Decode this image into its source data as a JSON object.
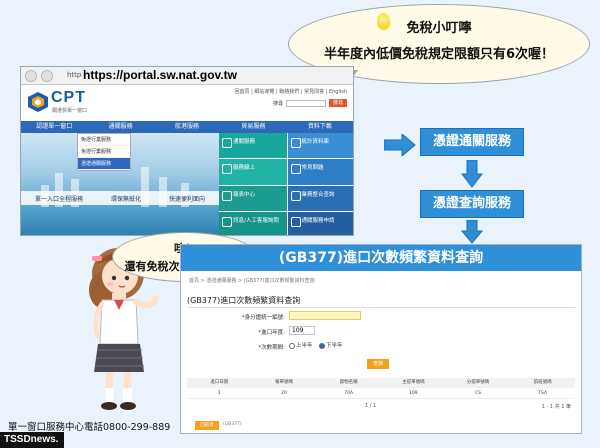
{
  "colors": {
    "accent_blue": "#2f8fd8",
    "menu_blue": "#2c69b6",
    "orange": "#f3a11b",
    "bubble": "#fffbe8"
  },
  "top_bubble": {
    "line1": "免稅小叮嚀",
    "line2": "半年度內低價免稅規定限額只有6次喔！",
    "icon": "lightbulb-icon"
  },
  "browser": {
    "url_prefix": "http",
    "url": "https://portal.sw.nat.gov.tw",
    "logo": "CPT",
    "logo_sub": "關港貿單一窗口",
    "top_links": "回首頁 | 網站導覽 | 聯絡我們 | 常見問答 | English",
    "search_label": "搜尋",
    "search_button": "搜尋",
    "menu": [
      "認證單一窗口",
      "通關服務",
      "航港服務",
      "貿易服務",
      "資料下載"
    ],
    "dropdown": [
      "免證行業服務",
      "免證行業服務",
      "憑證通關服務"
    ],
    "hero_links": [
      "單一入口全程服務",
      "環保無紙化",
      "快速便利面向"
    ],
    "tiles": [
      "通關服務",
      "統計資料庫",
      "服務線上",
      "常見問題",
      "報表中心",
      "業務整合查詢",
      "訊息/人工客服詢問",
      "通關服務申請"
    ]
  },
  "flow": {
    "box1": "憑證通關服務",
    "box2": "憑證查詢服務"
  },
  "wa_bubble": {
    "line1": "哇！",
    "line2": "還有免稅次數可用真好！"
  },
  "panel": {
    "title": "(GB377)進口次數頻繁資料查詢",
    "breadcrumb": "首頁 > 憑證通關服務 > (GB377)進口次數頻繁資料查詢",
    "page_title": "(GB377)進口次數頻繁資料查詢",
    "field1_label": "*身分證統一編號:",
    "field1_value": "",
    "field2_label": "*進口年度:",
    "field2_value": "109",
    "field3_label": "*次數期間:",
    "radio1": "上半年",
    "radio2": "下半年",
    "query_button": "查詢",
    "columns": [
      "進口日期",
      "報單號碼",
      "貨物名稱",
      "主提單號碼",
      "分提單號碼",
      "航班號碼"
    ],
    "row": [
      "1",
      "20",
      "70A",
      "109",
      "CS",
      "TSA"
    ],
    "pager": "1  /  1",
    "pager_right": "1 - 1 共 1 筆",
    "footer_button": "回前頁",
    "footer_tag": "(GB377)"
  },
  "hotline": "單一窗口服務中心電話0800-299-889",
  "watermark": "TSSDnews."
}
